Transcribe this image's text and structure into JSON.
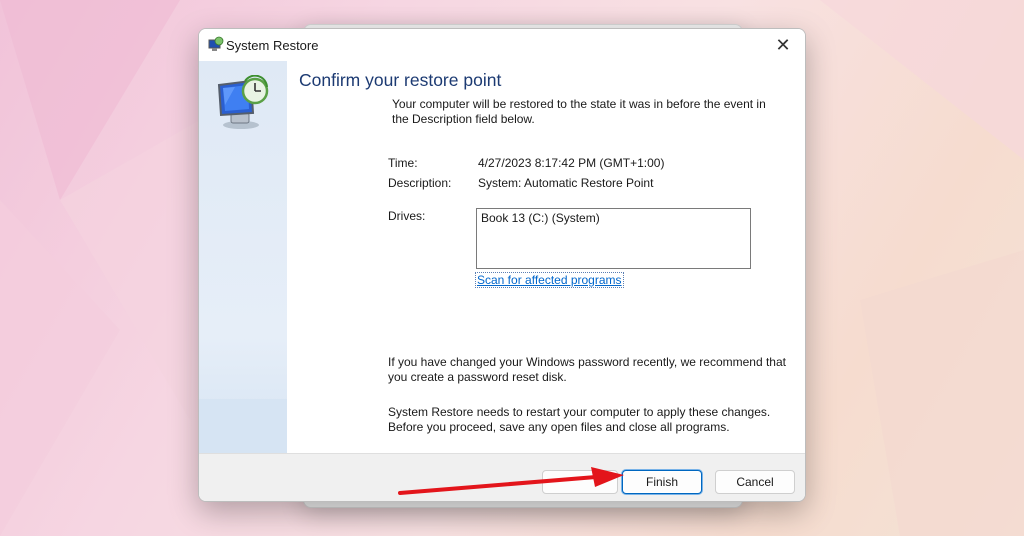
{
  "window": {
    "title": "System Restore"
  },
  "main": {
    "heading": "Confirm your restore point",
    "intro": "Your computer will be restored to the state it was in before the event in the Description field below.",
    "time_label": "Time:",
    "time_value": "4/27/2023 8:17:42 PM (GMT+1:00)",
    "description_label": "Description:",
    "description_value": "System: Automatic Restore Point",
    "drives_label": "Drives:",
    "drives": [
      "Book 13 (C:) (System)"
    ],
    "scan_link": "Scan for affected programs",
    "password_note": "If you have changed your Windows password recently, we recommend that you create a password reset disk.",
    "restart_note": "System Restore needs to restart your computer to apply these changes. Before you proceed, save any open files and close all programs."
  },
  "footer": {
    "finish_label": "Finish",
    "cancel_label": "Cancel"
  },
  "icons": {
    "title": "system-restore-icon",
    "sidebar": "monitor-clock-icon",
    "close": "close-icon",
    "annotation": "red-arrow-icon"
  },
  "colors": {
    "heading": "#1c3a72",
    "link": "#0066cc",
    "arrow": "#e3151b",
    "sidebar": "#dfe9f5"
  }
}
